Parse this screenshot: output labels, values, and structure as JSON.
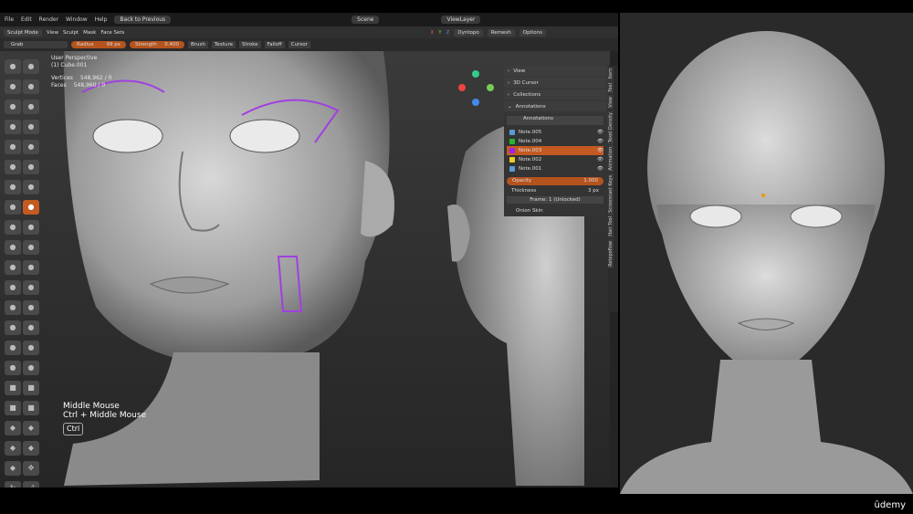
{
  "menu": [
    "File",
    "Edit",
    "Render",
    "Window",
    "Help"
  ],
  "topbar": {
    "back": "Back to Previous",
    "scene": "Scene",
    "viewlayer": "ViewLayer"
  },
  "header": {
    "mode": "Sculpt Mode",
    "menus": [
      "View",
      "Sculpt",
      "Mask",
      "Face Sets"
    ],
    "axes": [
      "X",
      "Y",
      "Z"
    ],
    "dyntopo": "Dyntopo",
    "remesh": "Remesh",
    "options": "Options"
  },
  "tool": {
    "brush_name": "Grab",
    "radius_label": "Radius",
    "radius_value": "99 px",
    "strength_label": "Strength",
    "strength_value": "0.400",
    "menus": [
      "Brush",
      "Texture",
      "Stroke",
      "Falloff",
      "Cursor"
    ]
  },
  "info": {
    "perspective": "User Perspective",
    "object": "(1) Cube.001",
    "vertices_label": "Vertices",
    "vertices": "548,962 / 0",
    "faces_label": "Faces",
    "faces": "548,960 / 0"
  },
  "hint": {
    "line1": "Middle Mouse",
    "line2": "Ctrl + Middle Mouse",
    "key": "Ctrl"
  },
  "panel": {
    "sections": [
      "View",
      "3D Cursor",
      "Collections",
      "Annotations"
    ],
    "datablock": "Annotations",
    "notes": [
      {
        "name": "Note.005",
        "color": "#5b9bd5",
        "selected": false
      },
      {
        "name": "Note.004",
        "color": "#2ab52a",
        "selected": false
      },
      {
        "name": "Note.003",
        "color": "#a020f0",
        "selected": true
      },
      {
        "name": "Note.002",
        "color": "#e8d020",
        "selected": false
      },
      {
        "name": "Note.001",
        "color": "#5b9bd5",
        "selected": false
      }
    ],
    "opacity_label": "Opacity",
    "opacity_value": "1.000",
    "thickness_label": "Thickness",
    "thickness_value": "3 px",
    "frame": "Frame: 1 (Unlocked)",
    "onion": "Onion Skin"
  },
  "tabs": [
    "Item",
    "Tool",
    "View",
    "Texel Density",
    "Animation",
    "Screencast Keys",
    "Hair Tool",
    "Retopoflow"
  ],
  "watermark": "ūdemy"
}
